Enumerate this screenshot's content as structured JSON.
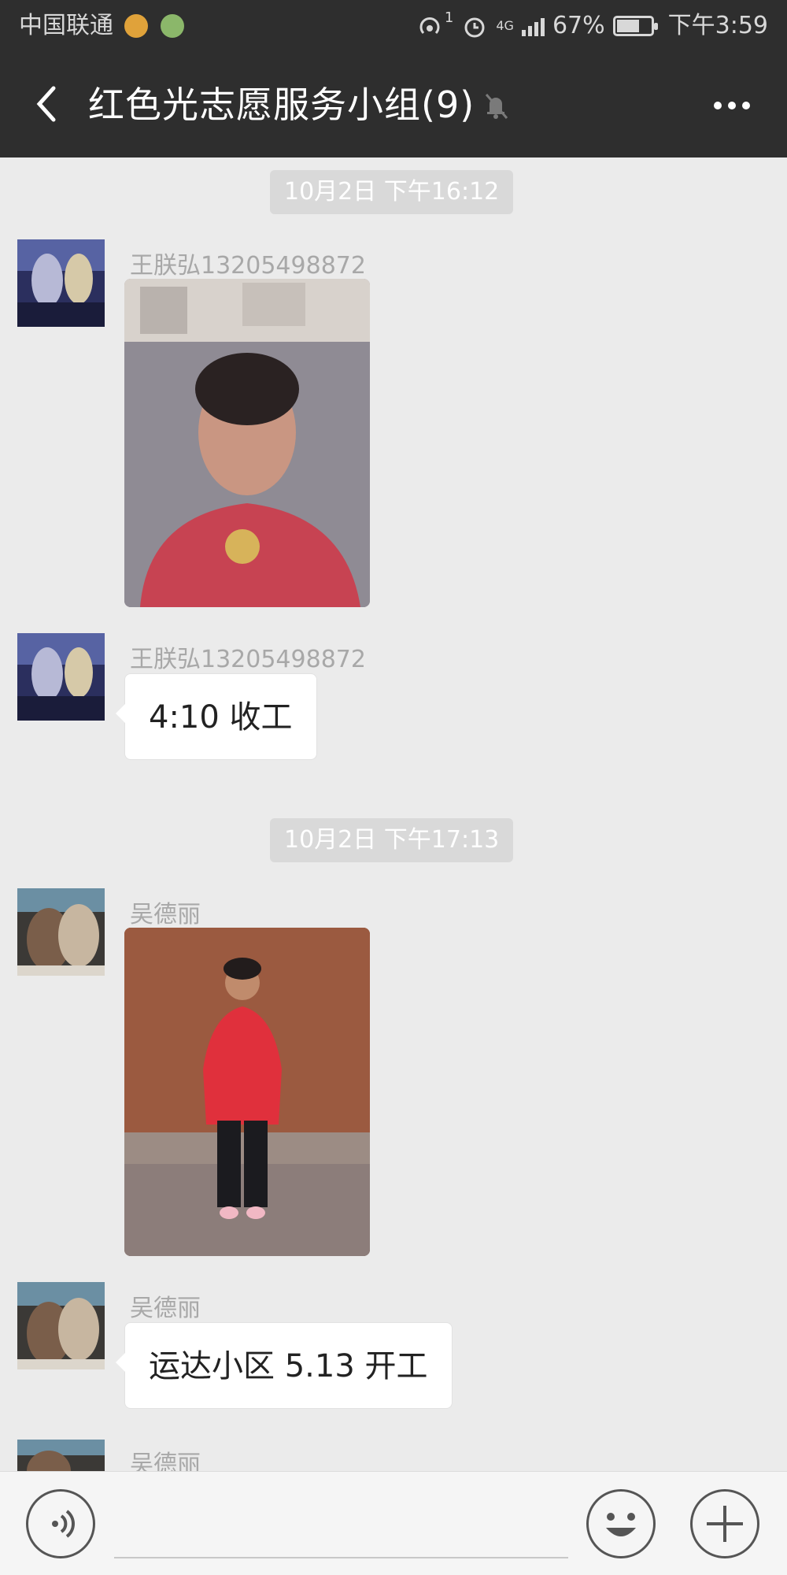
{
  "status_bar": {
    "carrier": "中国联通",
    "battery": "67%",
    "battery_level": 0.67,
    "time": "下午3:59",
    "network": "4G",
    "hotspot_count": "1"
  },
  "header": {
    "title": "红色光志愿服务小组(9)"
  },
  "messages": [
    {
      "type": "timestamp",
      "text": "10月2日 下午16:12"
    },
    {
      "type": "image",
      "sender": "王朕弘13205498872"
    },
    {
      "type": "text",
      "sender": "王朕弘13205498872",
      "text": "4:10 收工"
    },
    {
      "type": "timestamp",
      "text": "10月2日 下午17:13"
    },
    {
      "type": "image",
      "sender": "吴德丽"
    },
    {
      "type": "text",
      "sender": "吴德丽",
      "text": "运达小区 5.13 开工"
    },
    {
      "type": "partial",
      "sender": "吴德丽"
    }
  ],
  "colors": {
    "header_bg": "#2e2e2e",
    "chat_bg": "#ebebeb",
    "timestamp_bg": "#d9d9d9",
    "bubble_bg": "#ffffff"
  },
  "icons": {
    "back": "chevron-left-icon",
    "mute": "bell-off-icon",
    "more": "more-icon",
    "voice": "voice-icon",
    "emoji": "emoji-icon",
    "add": "plus-icon"
  }
}
